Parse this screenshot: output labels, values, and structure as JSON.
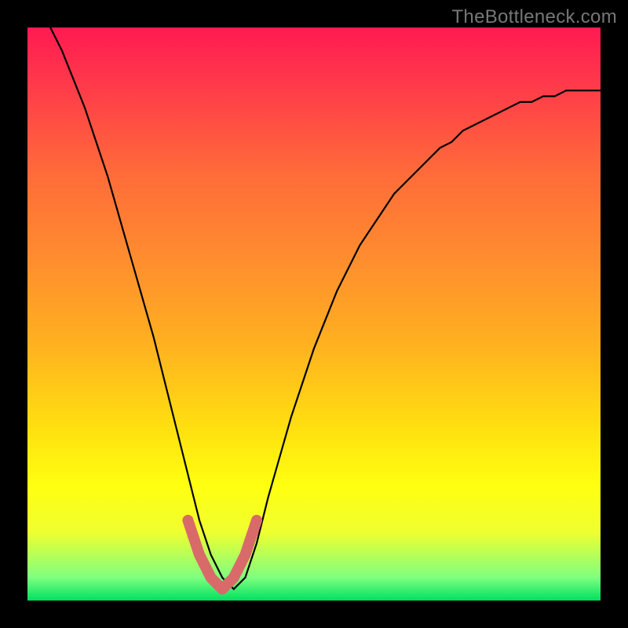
{
  "watermark": "TheBottleneck.com",
  "colors": {
    "curve": "#000000",
    "highlight": "#d96a6a",
    "gradient_top": "#ff1a52",
    "gradient_bottom": "#00e060",
    "frame": "#000000"
  },
  "chart_data": {
    "type": "line",
    "title": "",
    "xlabel": "",
    "ylabel": "",
    "xlim": [
      0,
      100
    ],
    "ylim": [
      0,
      100
    ],
    "x": [
      2,
      4,
      6,
      8,
      10,
      12,
      14,
      16,
      18,
      20,
      22,
      24,
      26,
      28,
      30,
      32,
      34,
      36,
      38,
      40,
      42,
      44,
      46,
      48,
      50,
      52,
      54,
      56,
      58,
      60,
      62,
      64,
      66,
      68,
      70,
      72,
      74,
      76,
      78,
      80,
      82,
      84,
      86,
      88,
      90,
      92,
      94,
      96,
      98,
      100
    ],
    "series": [
      {
        "name": "bottleneck_curve",
        "values": [
          103,
          100,
          96,
          91,
          86,
          80,
          74,
          67,
          60,
          53,
          46,
          38,
          30,
          22,
          14,
          8,
          4,
          2,
          4,
          10,
          18,
          25,
          32,
          38,
          44,
          49,
          54,
          58,
          62,
          65,
          68,
          71,
          73,
          75,
          77,
          79,
          80,
          82,
          83,
          84,
          85,
          86,
          87,
          87,
          88,
          88,
          89,
          89,
          89,
          89
        ]
      },
      {
        "name": "highlight_region",
        "x": [
          28,
          30,
          32,
          34,
          36,
          38,
          40
        ],
        "values": [
          14,
          8,
          4,
          2,
          4,
          8,
          14
        ]
      }
    ],
    "notes": "V-shaped curve on vertical rainbow gradient (red=high bottleneck, green=low). Minimum near x≈34. Pink segment marks the low-bottleneck zone near the trough."
  }
}
